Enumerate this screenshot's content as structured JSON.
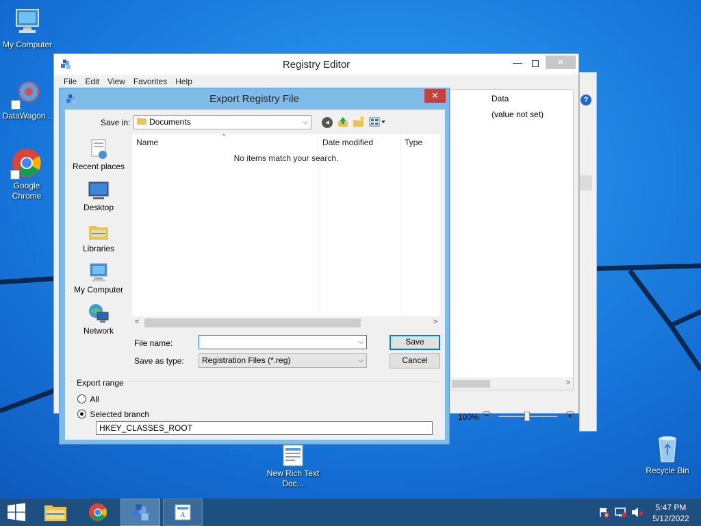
{
  "desktop": {
    "icons": [
      {
        "label": "My Computer"
      },
      {
        "label": "DataWagon..."
      },
      {
        "label": "Google Chrome"
      },
      {
        "label": "New Rich Text Doc..."
      },
      {
        "label": "Recycle Bin"
      }
    ]
  },
  "registry_editor": {
    "title": "Registry Editor",
    "menu": [
      "File",
      "Edit",
      "View",
      "Favorites",
      "Help"
    ],
    "data_column_header": "Data",
    "data_value": "(value not set)",
    "zoom_level": "100%"
  },
  "export_dialog": {
    "title": "Export Registry File",
    "close_glyph": "✕",
    "save_in_label": "Save in:",
    "save_in_value": "Documents",
    "places": [
      {
        "label": "Recent places"
      },
      {
        "label": "Desktop"
      },
      {
        "label": "Libraries"
      },
      {
        "label": "My Computer"
      },
      {
        "label": "Network"
      }
    ],
    "columns": {
      "name": "Name",
      "date_modified": "Date modified",
      "type": "Type"
    },
    "empty_message": "No items match your search.",
    "file_name_label": "File name:",
    "file_name_value": "",
    "save_as_type_label": "Save as type:",
    "save_as_type_value": "Registration Files (*.reg)",
    "save_button": "Save",
    "cancel_button": "Cancel",
    "export_range": {
      "label": "Export range",
      "all_label": "All",
      "selected_branch_label": "Selected branch",
      "selected": "selected_branch",
      "branch_value": "HKEY_CLASSES_ROOT"
    }
  },
  "taskbar": {
    "time": "5:47 PM",
    "date": "5/12/2022"
  },
  "colors": {
    "desktop": "#1a73d6",
    "taskbar": "#1d4f80",
    "dialog_frame": "#7fbbe8",
    "close_button": "#c7403a",
    "accent": "#0078d7"
  }
}
